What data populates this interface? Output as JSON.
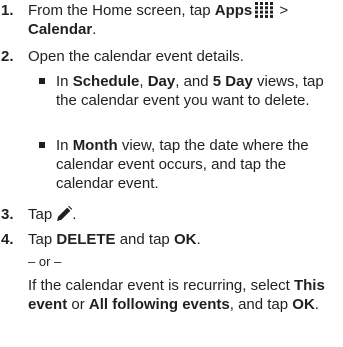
{
  "steps": [
    {
      "num": "1.",
      "pre": "From the Home screen, tap ",
      "bold1": "Apps",
      "mid": " > ",
      "bold2": "Calendar",
      "post": "."
    },
    {
      "num": "2.",
      "text": "Open the calendar event details."
    },
    {
      "num": "3.",
      "text": "Tap",
      "post": "."
    },
    {
      "num": "4.",
      "pre": "Tap ",
      "bold1": "DELETE",
      "mid": " and tap ",
      "bold2": "OK",
      "post": "."
    }
  ],
  "substeps": [
    {
      "pre": "In ",
      "b1": "Schedule",
      "t1": ", ",
      "b2": "Day",
      "t2": ", and ",
      "b3": "5 Day",
      "t3": " views, tap the calendar event you want to delete."
    },
    {
      "pre": "In ",
      "b1": "Month",
      "t1": " view, tap the date where the calendar event occurs, and tap the calendar event."
    }
  ],
  "or_text": "– or –",
  "recurring": {
    "pre": "If the calendar event is recurring, select ",
    "b1": "This event",
    "t1": " or ",
    "b2": "All following events",
    "t2": ", and tap ",
    "b3": "OK",
    "t3": "."
  },
  "icons": {
    "apps": "apps-grid-icon",
    "edit": "pencil-icon"
  }
}
